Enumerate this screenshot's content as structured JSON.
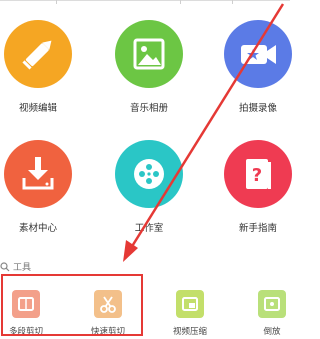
{
  "apps": [
    {
      "key": "video-edit",
      "label": "视频编辑",
      "color": "#f5a623",
      "icon": "pencil-icon"
    },
    {
      "key": "music-album",
      "label": "音乐相册",
      "color": "#6cc644",
      "icon": "image-icon"
    },
    {
      "key": "shoot-record",
      "label": "拍摄录像",
      "color": "#5b7be6",
      "icon": "video-camera-icon"
    },
    {
      "key": "material-center",
      "label": "素材中心",
      "color": "#f0623f",
      "icon": "download-tray-icon"
    },
    {
      "key": "studio",
      "label": "工作室",
      "color": "#2ac6c6",
      "icon": "film-reel-icon"
    },
    {
      "key": "beginner-guide",
      "label": "新手指南",
      "color": "#ef3b52",
      "icon": "help-book-icon"
    }
  ],
  "tools_heading": "工具",
  "tools": [
    {
      "key": "multi-cut",
      "label": "多段剪切",
      "color": "#f3a08a",
      "icon": "multi-cut-icon"
    },
    {
      "key": "quick-cut",
      "label": "快速剪切",
      "color": "#f3c08a",
      "icon": "scissors-icon"
    },
    {
      "key": "video-compress",
      "label": "视频压缩",
      "color": "#c3df6a",
      "icon": "compress-icon"
    },
    {
      "key": "reverse",
      "label": "倒放",
      "color": "#b9e07a",
      "icon": "reverse-play-icon"
    }
  ],
  "annotation": {
    "color": "#e53935"
  }
}
